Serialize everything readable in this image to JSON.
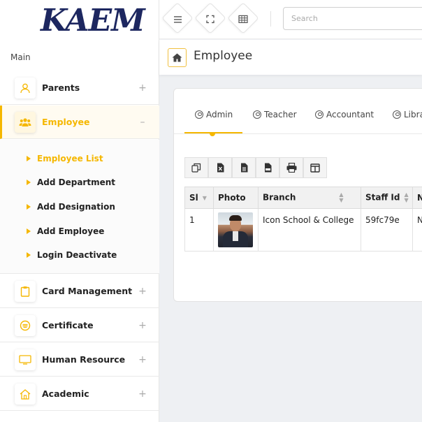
{
  "brand": {
    "logo_text": "KAEM",
    "logo_color": "#1d2760",
    "accent": "#f5b700"
  },
  "sidebar": {
    "section_label": "Main",
    "items": [
      {
        "label": "Parents",
        "icon": "user-icon",
        "toggle": "+"
      },
      {
        "label": "Employee",
        "icon": "users-icon",
        "toggle": "–",
        "active": true
      },
      {
        "label": "Card Management",
        "icon": "clipboard-icon",
        "toggle": "+"
      },
      {
        "label": "Certificate",
        "icon": "certificate-icon",
        "toggle": "+"
      },
      {
        "label": "Human Resource",
        "icon": "monitor-icon",
        "toggle": "+"
      },
      {
        "label": "Academic",
        "icon": "home-icon",
        "toggle": "+"
      }
    ],
    "employee_submenu": [
      {
        "label": "Employee List",
        "active": true
      },
      {
        "label": "Add Department"
      },
      {
        "label": "Add Designation"
      },
      {
        "label": "Add Employee"
      },
      {
        "label": "Login Deactivate"
      }
    ]
  },
  "topbar": {
    "tools": [
      "menu-icon",
      "fullscreen-icon",
      "grid-icon"
    ],
    "search_placeholder": "Search"
  },
  "page": {
    "title": "Employee"
  },
  "tabs": [
    {
      "label": "Admin",
      "active": true
    },
    {
      "label": "Teacher"
    },
    {
      "label": "Accountant"
    },
    {
      "label": "Libra"
    }
  ],
  "export_buttons": [
    "copy-icon",
    "excel-icon",
    "csv-icon",
    "pdf-icon",
    "print-icon",
    "columns-icon"
  ],
  "table": {
    "headers": [
      "Sl",
      "Photo",
      "Branch",
      "Staff Id",
      "N"
    ],
    "rows": [
      {
        "sl": "1",
        "branch": "Icon School & College",
        "staff_id": "59fc79e",
        "name": "N"
      }
    ]
  }
}
